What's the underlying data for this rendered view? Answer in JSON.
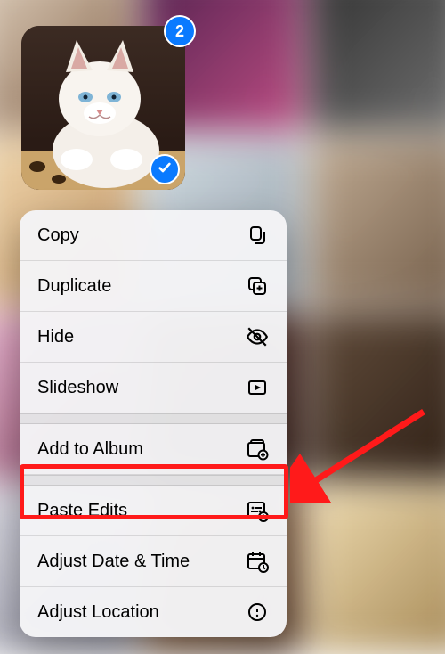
{
  "selection": {
    "count": "2",
    "checked": true
  },
  "menu": {
    "items": [
      {
        "label": "Copy",
        "icon": "copy-icon"
      },
      {
        "label": "Duplicate",
        "icon": "duplicate-icon"
      },
      {
        "label": "Hide",
        "icon": "hide-icon"
      },
      {
        "label": "Slideshow",
        "icon": "slideshow-icon"
      }
    ],
    "items2": [
      {
        "label": "Add to Album",
        "icon": "add-to-album-icon"
      }
    ],
    "items3": [
      {
        "label": "Paste Edits",
        "icon": "paste-edits-icon",
        "highlighted": true
      },
      {
        "label": "Adjust Date & Time",
        "icon": "adjust-date-time-icon"
      },
      {
        "label": "Adjust Location",
        "icon": "adjust-location-icon"
      }
    ]
  },
  "annotation": {
    "highlight": "Paste Edits"
  }
}
